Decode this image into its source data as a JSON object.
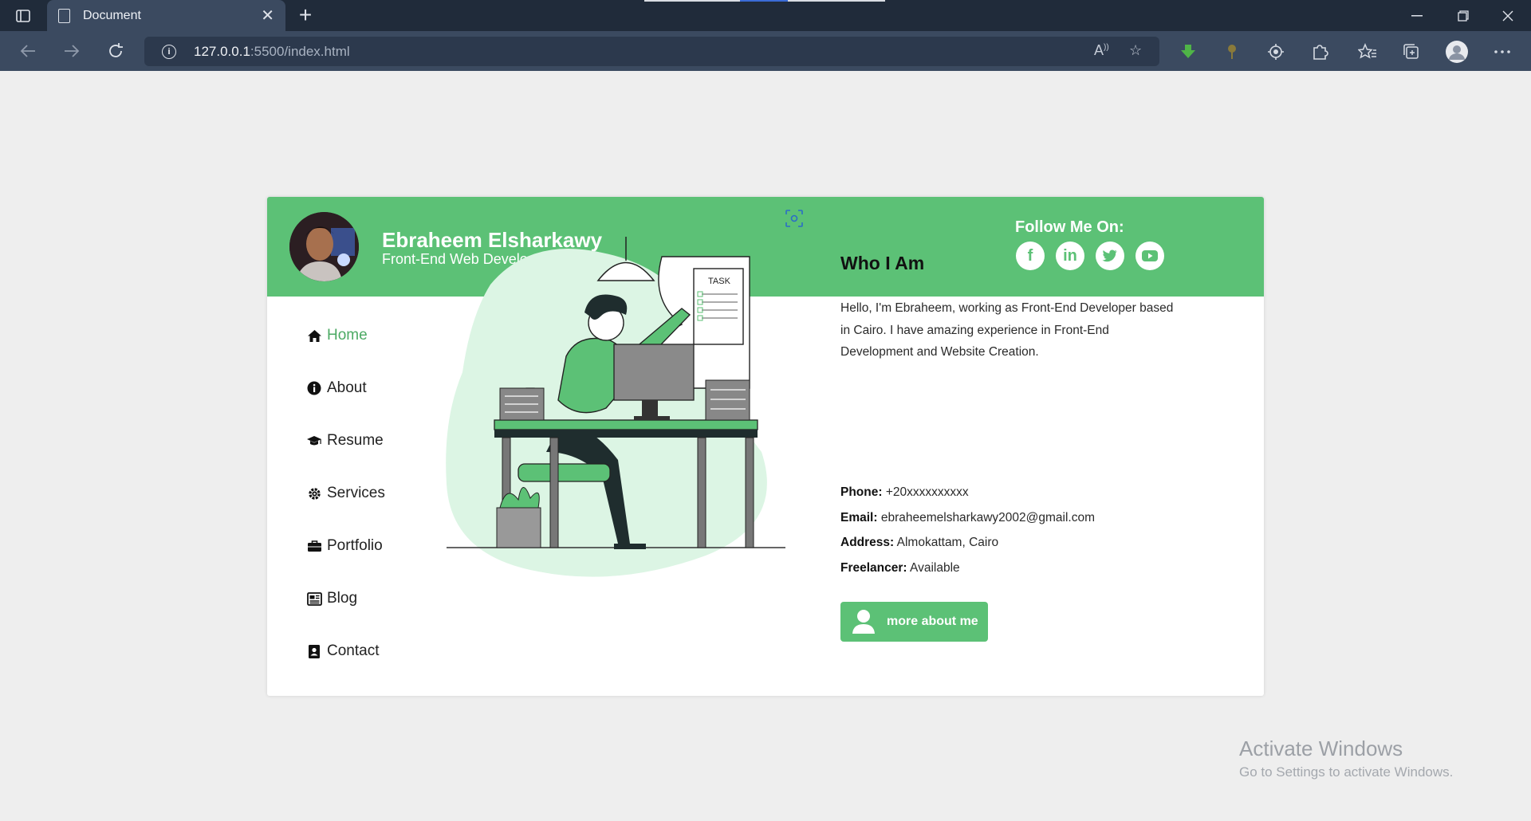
{
  "browser": {
    "tab_title": "Document",
    "url_host": "127.0.0.1",
    "url_path": ":5500/index.html"
  },
  "header": {
    "name": "Ebraheem Elsharkawy",
    "role": "Front-End Web Developer",
    "follow_label": "Follow Me On:",
    "socials": [
      {
        "name": "facebook",
        "glyph": "f"
      },
      {
        "name": "linkedin",
        "glyph": "in"
      },
      {
        "name": "twitter",
        "glyph": "t"
      },
      {
        "name": "youtube",
        "glyph": "▶"
      }
    ]
  },
  "nav": {
    "items": [
      {
        "label": "Home",
        "icon": "home-icon",
        "active": true
      },
      {
        "label": "About",
        "icon": "info-icon",
        "active": false
      },
      {
        "label": "Resume",
        "icon": "graduation-cap-icon",
        "active": false
      },
      {
        "label": "Services",
        "icon": "gear-icon",
        "active": false
      },
      {
        "label": "Portfolio",
        "icon": "briefcase-icon",
        "active": false
      },
      {
        "label": "Blog",
        "icon": "newspaper-icon",
        "active": false
      },
      {
        "label": "Contact",
        "icon": "contact-card-icon",
        "active": false
      }
    ]
  },
  "about": {
    "title": "Who I Am",
    "bio": "Hello, I'm Ebraheem, working as Front-End Developer based in Cairo. I have amazing experience in Front-End Development and Website Creation.",
    "phone_label": "Phone:",
    "phone": "+20xxxxxxxxxx",
    "email_label": "Email:",
    "email": "ebraheemelsharkawy2002@gmail.com",
    "address_label": "Address:",
    "address": "Almokattam, Cairo",
    "freelancer_label": "Freelancer:",
    "freelancer": "Available",
    "button_label": "more about me"
  },
  "illustration": {
    "task_label": "TASK"
  },
  "watermark": {
    "title": "Activate Windows",
    "subtitle": "Go to Settings to activate Windows."
  },
  "colors": {
    "accent": "#5cc176",
    "chrome_dark": "#202b3a",
    "chrome_mid": "#3b4a60"
  }
}
